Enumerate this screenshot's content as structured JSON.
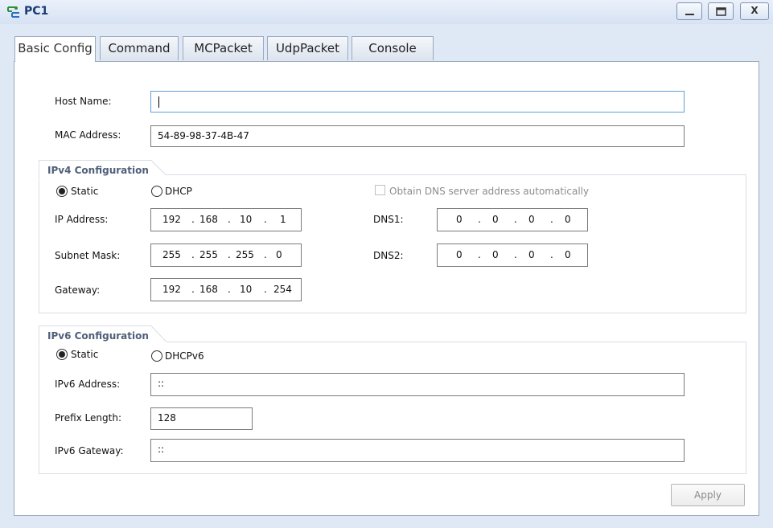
{
  "window": {
    "title": "PC1",
    "close_label": "X"
  },
  "tabs": [
    "Basic Config",
    "Command",
    "MCPacket",
    "UdpPacket",
    "Console"
  ],
  "basic": {
    "host_name_label": "Host Name:",
    "host_name_value": "",
    "mac_label": "MAC Address:",
    "mac_value": "54-89-98-37-4B-47"
  },
  "ipv4": {
    "group_title": "IPv4 Configuration",
    "static_label": "Static",
    "dhcp_label": "DHCP",
    "mode": "Static",
    "obtain_dns_label": "Obtain DNS server address automatically",
    "obtain_dns_checked": false,
    "ip_label": "IP Address:",
    "ip": [
      "192",
      "168",
      "10",
      "1"
    ],
    "mask_label": "Subnet Mask:",
    "mask": [
      "255",
      "255",
      "255",
      "0"
    ],
    "gateway_label": "Gateway:",
    "gateway": [
      "192",
      "168",
      "10",
      "254"
    ],
    "dns1_label": "DNS1:",
    "dns1": [
      "0",
      "0",
      "0",
      "0"
    ],
    "dns2_label": "DNS2:",
    "dns2": [
      "0",
      "0",
      "0",
      "0"
    ]
  },
  "ipv6": {
    "group_title": "IPv6 Configuration",
    "static_label": "Static",
    "dhcp_label": "DHCPv6",
    "mode": "Static",
    "address_label": "IPv6 Address:",
    "address_value": "::",
    "prefix_label": "Prefix Length:",
    "prefix_value": "128",
    "gateway_label": "IPv6 Gateway:",
    "gateway_value": "::"
  },
  "apply_label": "Apply",
  "ip_separator": "."
}
